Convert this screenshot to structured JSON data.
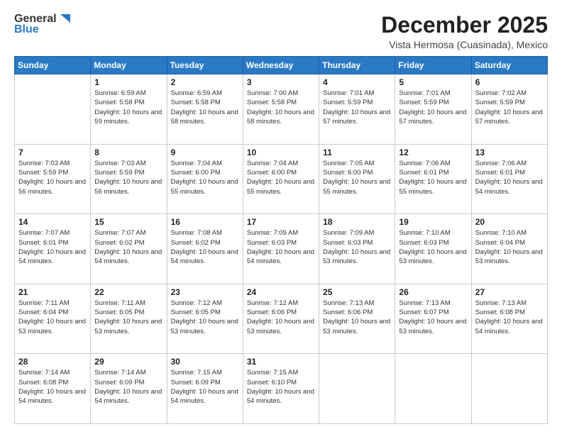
{
  "logo": {
    "line1": "General",
    "line2": "Blue"
  },
  "header": {
    "month": "December 2025",
    "location": "Vista Hermosa (Cuasinada), Mexico"
  },
  "weekdays": [
    "Sunday",
    "Monday",
    "Tuesday",
    "Wednesday",
    "Thursday",
    "Friday",
    "Saturday"
  ],
  "weeks": [
    [
      {
        "day": "",
        "sunrise": "",
        "sunset": "",
        "daylight": ""
      },
      {
        "day": "1",
        "sunrise": "Sunrise: 6:59 AM",
        "sunset": "Sunset: 5:58 PM",
        "daylight": "Daylight: 10 hours and 59 minutes."
      },
      {
        "day": "2",
        "sunrise": "Sunrise: 6:59 AM",
        "sunset": "Sunset: 5:58 PM",
        "daylight": "Daylight: 10 hours and 58 minutes."
      },
      {
        "day": "3",
        "sunrise": "Sunrise: 7:00 AM",
        "sunset": "Sunset: 5:58 PM",
        "daylight": "Daylight: 10 hours and 58 minutes."
      },
      {
        "day": "4",
        "sunrise": "Sunrise: 7:01 AM",
        "sunset": "Sunset: 5:59 PM",
        "daylight": "Daylight: 10 hours and 57 minutes."
      },
      {
        "day": "5",
        "sunrise": "Sunrise: 7:01 AM",
        "sunset": "Sunset: 5:59 PM",
        "daylight": "Daylight: 10 hours and 57 minutes."
      },
      {
        "day": "6",
        "sunrise": "Sunrise: 7:02 AM",
        "sunset": "Sunset: 5:59 PM",
        "daylight": "Daylight: 10 hours and 57 minutes."
      }
    ],
    [
      {
        "day": "7",
        "sunrise": "Sunrise: 7:03 AM",
        "sunset": "Sunset: 5:59 PM",
        "daylight": "Daylight: 10 hours and 56 minutes."
      },
      {
        "day": "8",
        "sunrise": "Sunrise: 7:03 AM",
        "sunset": "Sunset: 5:59 PM",
        "daylight": "Daylight: 10 hours and 56 minutes."
      },
      {
        "day": "9",
        "sunrise": "Sunrise: 7:04 AM",
        "sunset": "Sunset: 6:00 PM",
        "daylight": "Daylight: 10 hours and 55 minutes."
      },
      {
        "day": "10",
        "sunrise": "Sunrise: 7:04 AM",
        "sunset": "Sunset: 6:00 PM",
        "daylight": "Daylight: 10 hours and 55 minutes."
      },
      {
        "day": "11",
        "sunrise": "Sunrise: 7:05 AM",
        "sunset": "Sunset: 6:00 PM",
        "daylight": "Daylight: 10 hours and 55 minutes."
      },
      {
        "day": "12",
        "sunrise": "Sunrise: 7:06 AM",
        "sunset": "Sunset: 6:01 PM",
        "daylight": "Daylight: 10 hours and 55 minutes."
      },
      {
        "day": "13",
        "sunrise": "Sunrise: 7:06 AM",
        "sunset": "Sunset: 6:01 PM",
        "daylight": "Daylight: 10 hours and 54 minutes."
      }
    ],
    [
      {
        "day": "14",
        "sunrise": "Sunrise: 7:07 AM",
        "sunset": "Sunset: 6:01 PM",
        "daylight": "Daylight: 10 hours and 54 minutes."
      },
      {
        "day": "15",
        "sunrise": "Sunrise: 7:07 AM",
        "sunset": "Sunset: 6:02 PM",
        "daylight": "Daylight: 10 hours and 54 minutes."
      },
      {
        "day": "16",
        "sunrise": "Sunrise: 7:08 AM",
        "sunset": "Sunset: 6:02 PM",
        "daylight": "Daylight: 10 hours and 54 minutes."
      },
      {
        "day": "17",
        "sunrise": "Sunrise: 7:09 AM",
        "sunset": "Sunset: 6:03 PM",
        "daylight": "Daylight: 10 hours and 54 minutes."
      },
      {
        "day": "18",
        "sunrise": "Sunrise: 7:09 AM",
        "sunset": "Sunset: 6:03 PM",
        "daylight": "Daylight: 10 hours and 53 minutes."
      },
      {
        "day": "19",
        "sunrise": "Sunrise: 7:10 AM",
        "sunset": "Sunset: 6:03 PM",
        "daylight": "Daylight: 10 hours and 53 minutes."
      },
      {
        "day": "20",
        "sunrise": "Sunrise: 7:10 AM",
        "sunset": "Sunset: 6:04 PM",
        "daylight": "Daylight: 10 hours and 53 minutes."
      }
    ],
    [
      {
        "day": "21",
        "sunrise": "Sunrise: 7:11 AM",
        "sunset": "Sunset: 6:04 PM",
        "daylight": "Daylight: 10 hours and 53 minutes."
      },
      {
        "day": "22",
        "sunrise": "Sunrise: 7:11 AM",
        "sunset": "Sunset: 6:05 PM",
        "daylight": "Daylight: 10 hours and 53 minutes."
      },
      {
        "day": "23",
        "sunrise": "Sunrise: 7:12 AM",
        "sunset": "Sunset: 6:05 PM",
        "daylight": "Daylight: 10 hours and 53 minutes."
      },
      {
        "day": "24",
        "sunrise": "Sunrise: 7:12 AM",
        "sunset": "Sunset: 6:06 PM",
        "daylight": "Daylight: 10 hours and 53 minutes."
      },
      {
        "day": "25",
        "sunrise": "Sunrise: 7:13 AM",
        "sunset": "Sunset: 6:06 PM",
        "daylight": "Daylight: 10 hours and 53 minutes."
      },
      {
        "day": "26",
        "sunrise": "Sunrise: 7:13 AM",
        "sunset": "Sunset: 6:07 PM",
        "daylight": "Daylight: 10 hours and 53 minutes."
      },
      {
        "day": "27",
        "sunrise": "Sunrise: 7:13 AM",
        "sunset": "Sunset: 6:08 PM",
        "daylight": "Daylight: 10 hours and 54 minutes."
      }
    ],
    [
      {
        "day": "28",
        "sunrise": "Sunrise: 7:14 AM",
        "sunset": "Sunset: 6:08 PM",
        "daylight": "Daylight: 10 hours and 54 minutes."
      },
      {
        "day": "29",
        "sunrise": "Sunrise: 7:14 AM",
        "sunset": "Sunset: 6:09 PM",
        "daylight": "Daylight: 10 hours and 54 minutes."
      },
      {
        "day": "30",
        "sunrise": "Sunrise: 7:15 AM",
        "sunset": "Sunset: 6:09 PM",
        "daylight": "Daylight: 10 hours and 54 minutes."
      },
      {
        "day": "31",
        "sunrise": "Sunrise: 7:15 AM",
        "sunset": "Sunset: 6:10 PM",
        "daylight": "Daylight: 10 hours and 54 minutes."
      },
      {
        "day": "",
        "sunrise": "",
        "sunset": "",
        "daylight": ""
      },
      {
        "day": "",
        "sunrise": "",
        "sunset": "",
        "daylight": ""
      },
      {
        "day": "",
        "sunrise": "",
        "sunset": "",
        "daylight": ""
      }
    ]
  ]
}
